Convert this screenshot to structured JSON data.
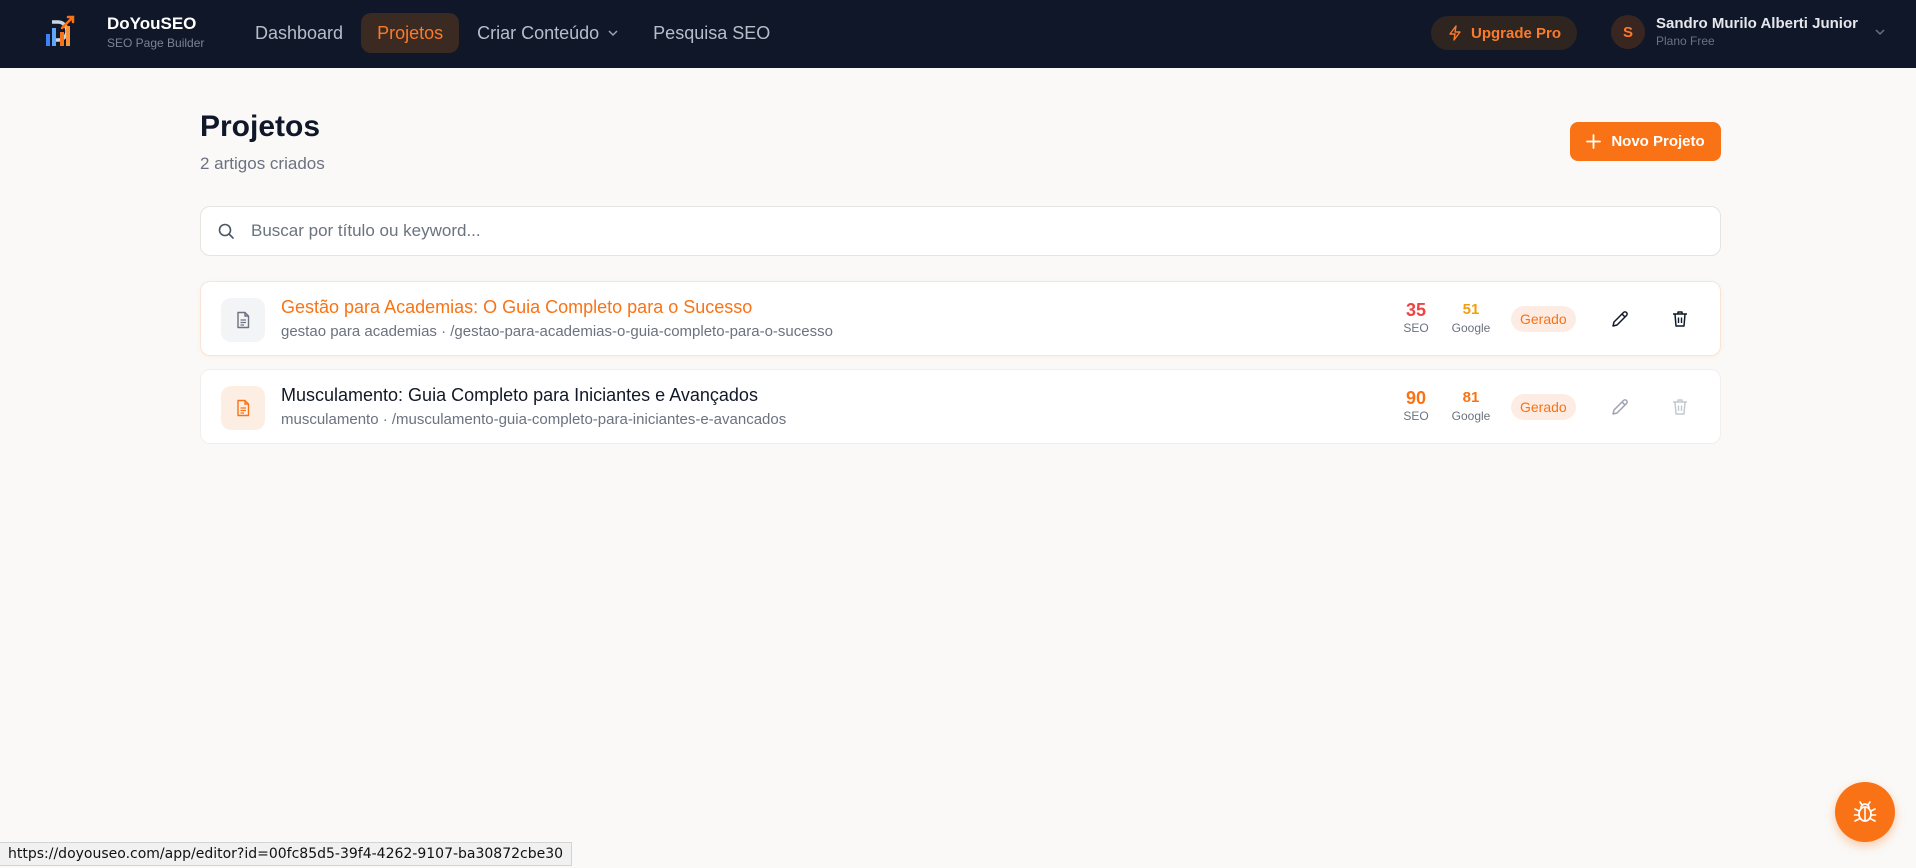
{
  "app": {
    "name": "DoYouSEO",
    "tagline": "SEO Page Builder",
    "logo_icon": "doyouseo-logo-icon"
  },
  "nav": {
    "items": [
      {
        "label": "Dashboard",
        "active": false
      },
      {
        "label": "Projetos",
        "active": true
      },
      {
        "label": "Criar Conteúdo",
        "active": false,
        "has_dropdown": true
      },
      {
        "label": "Pesquisa SEO",
        "active": false
      }
    ]
  },
  "upgrade": {
    "label": "Upgrade Pro",
    "icon": "lightning-icon"
  },
  "user": {
    "initial": "S",
    "name": "Sandro Murilo Alberti Junior",
    "plan": "Plano Free"
  },
  "page": {
    "title": "Projetos",
    "subtitle": "2 artigos criados",
    "new_button": "Novo Projeto"
  },
  "search": {
    "placeholder": "Buscar por título ou keyword...",
    "value": ""
  },
  "projects": [
    {
      "title": "Gestão para Academias: O Guia Completo para o Sucesso",
      "meta": "gestao para academias · /gestao-para-academias-o-guia-completo-para-o-sucesso",
      "seo_score": "35",
      "seo_label": "SEO",
      "google_score": "51",
      "google_label": "Google",
      "status": "Gerado"
    },
    {
      "title": "Musculamento: Guia Completo para Iniciantes e Avançados",
      "meta": "musculamento · /musculamento-guia-completo-para-iniciantes-e-avancados",
      "seo_score": "90",
      "seo_label": "SEO",
      "google_score": "81",
      "google_label": "Google",
      "status": "Gerado"
    }
  ],
  "status_bar": {
    "url": "https://doyouseo.com/app/editor?id=00fc85d5-39f4-4262-9107-ba30872cbe30"
  },
  "colors": {
    "topbar_bg": "#0f1729",
    "accent": "#f97316",
    "score_low": "#ef4444",
    "score_mid": "#f59e0b",
    "score_high": "#f97316",
    "page_bg": "#faf9f7"
  },
  "fab": {
    "icon": "bug-icon"
  }
}
